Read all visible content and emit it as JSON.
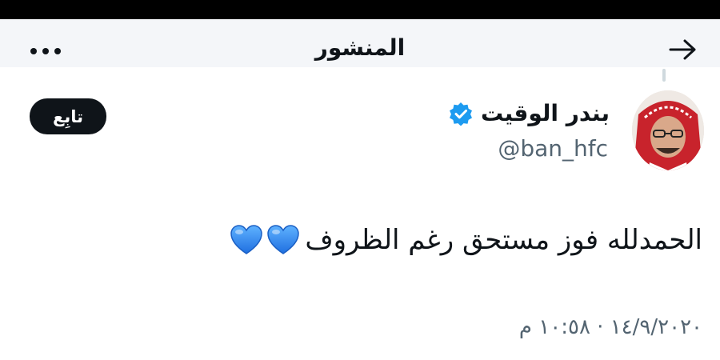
{
  "header": {
    "title": "المنشور",
    "back_icon": "arrow-right-icon",
    "more_icon": "more-dots-icon"
  },
  "author": {
    "display_name": "بندر الوقيت",
    "handle": "@ban_hfc",
    "verified": true,
    "verified_color": "#1d9bf0"
  },
  "follow_button": {
    "label": "تابِع"
  },
  "tweet": {
    "text": "الحمدلله فوز مستحق رغم الظروف",
    "emoji": [
      "blue-heart-icon",
      "blue-heart-icon"
    ],
    "timestamp": "١٤/٩/٢٠٢٠ · ١٠:٥٨ م"
  },
  "colors": {
    "text": "#0f1419",
    "secondary_text": "#536471",
    "heart_blue": "#2f8df5"
  }
}
